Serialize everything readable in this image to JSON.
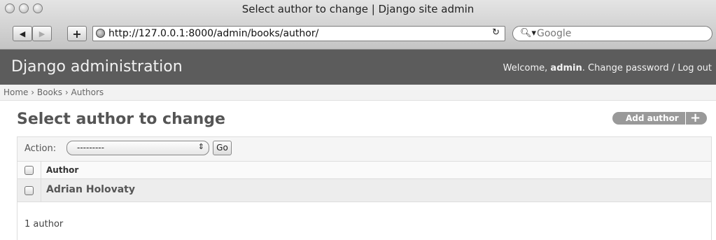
{
  "browser": {
    "window_title": "Select author to change | Django site admin",
    "url": "http://127.0.0.1:8000/admin/books/author/",
    "search_placeholder": "Google",
    "back_icon": "back-arrow-icon",
    "forward_icon": "forward-arrow-icon",
    "new_tab_icon": "plus-icon",
    "reload_icon": "reload-icon"
  },
  "header": {
    "brand": "Django administration",
    "welcome_prefix": "Welcome,",
    "username": "admin",
    "change_password": "Change password",
    "separator": "/",
    "logout": "Log out"
  },
  "breadcrumbs": [
    "Home",
    "Books",
    "Authors"
  ],
  "breadcrumb_sep": "›",
  "page": {
    "title": "Select author to change",
    "add_button": "Add author"
  },
  "actions": {
    "label": "Action:",
    "selected": "---------",
    "go": "Go"
  },
  "table": {
    "column": "Author",
    "rows": [
      "Adrian Holovaty"
    ]
  },
  "paginator": "1 author",
  "colors": {
    "header_bg": "#5c5c5c",
    "breadcrumb_bg": "#f2f2f2",
    "add_button_bg": "#999999"
  }
}
